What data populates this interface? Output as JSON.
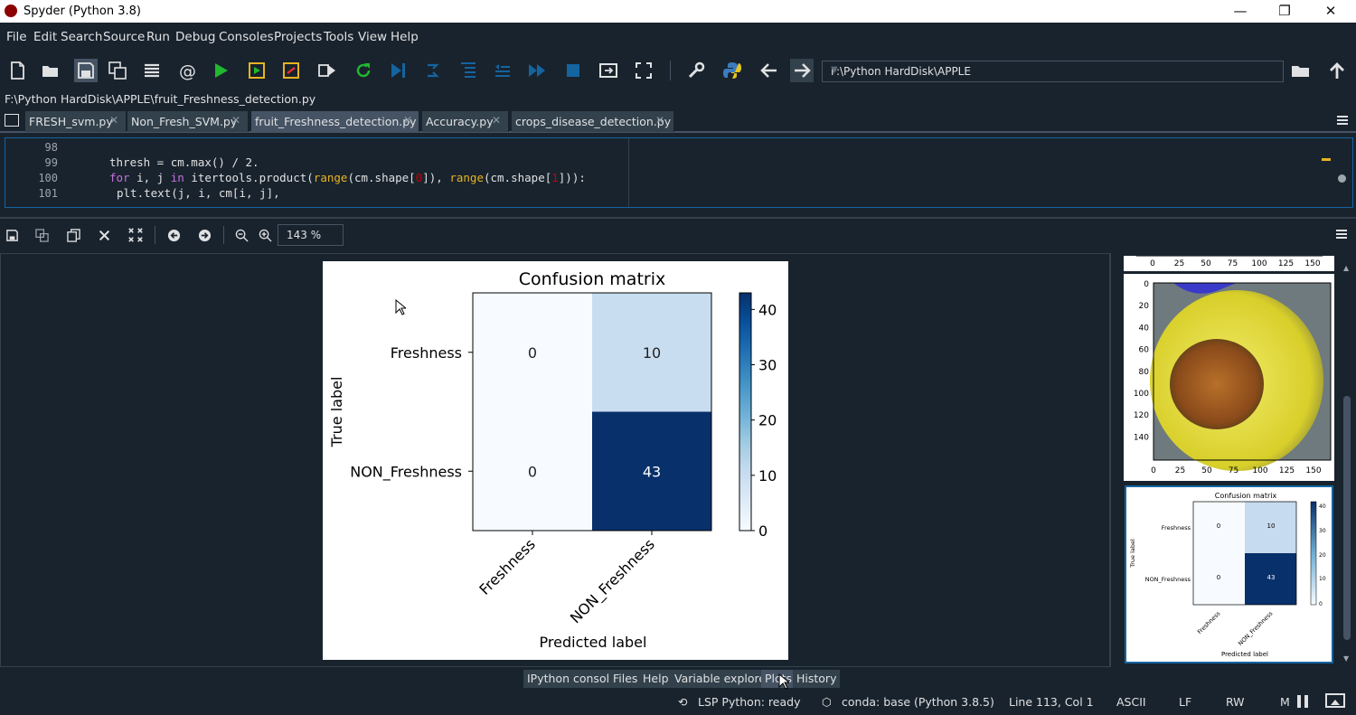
{
  "window": {
    "title": "Spyder (Python 3.8)",
    "minimize": "—",
    "maximize": "❐",
    "close": "✕"
  },
  "menu": [
    "File",
    "Edit",
    "Search",
    "Source",
    "Run",
    "Debug",
    "Consoles",
    "Projects",
    "Tools",
    "View",
    "Help"
  ],
  "toolbar": {
    "path": "F:\\Python HardDisk\\APPLE"
  },
  "editor": {
    "filepath": "F:\\Python HardDisk\\APPLE\\fruit_Freshness_detection.py",
    "tabs": [
      {
        "label": "FRESH_svm.py",
        "active": false
      },
      {
        "label": "Non_Fresh_SVM.py",
        "active": false
      },
      {
        "label": "fruit_Freshness_detection.py",
        "active": true
      },
      {
        "label": "Accuracy.py",
        "active": false
      },
      {
        "label": "crops_disease_detection.py",
        "active": false
      }
    ],
    "line_numbers": [
      "98",
      "99",
      "100",
      "101"
    ],
    "code_line1": "thresh = cm.max() / 2.",
    "code_line2_for": "for",
    "code_line2_mid": " i, j ",
    "code_line2_in": "in",
    "code_line2_a": " itertools.product(",
    "code_line2_range1": "range",
    "code_line2_b": "(cm.shape[",
    "code_line2_zero": "0",
    "code_line2_c": "]), ",
    "code_line2_range2": "range",
    "code_line2_d": "(cm.shape[",
    "code_line2_one": "1",
    "code_line2_e": "])):",
    "code_line3": "plt.text(j, i, cm[i, j],"
  },
  "plots": {
    "zoom": "143 %"
  },
  "chart_data": [
    {
      "type": "heatmap",
      "title": "Confusion matrix",
      "xlabel": "Predicted label",
      "ylabel": "True label",
      "x_categories": [
        "Freshness",
        "NON_Freshness"
      ],
      "y_categories": [
        "Freshness",
        "NON_Freshness"
      ],
      "values": [
        [
          0,
          10
        ],
        [
          0,
          43
        ]
      ],
      "colorbar_ticks": [
        0,
        10,
        20,
        30,
        40
      ],
      "colorbar_range": [
        0,
        43
      ],
      "colormap": "Blues"
    }
  ],
  "thumbnails": {
    "top_axis_ticks": [
      "0",
      "25",
      "50",
      "75",
      "100",
      "125",
      "150"
    ],
    "image_y_ticks": [
      "0",
      "20",
      "40",
      "60",
      "80",
      "100",
      "120",
      "140"
    ],
    "image_x_ticks": [
      "0",
      "25",
      "50",
      "75",
      "100",
      "125",
      "150"
    ],
    "cm_title": "Confusion matrix",
    "cm_ylabel": "True label",
    "cm_xlabel": "Predicted label",
    "cm_rows": [
      "Freshness",
      "NON_Freshness"
    ],
    "cm_cols": [
      "Freshness",
      "NON_Freshness"
    ],
    "cm_values": [
      "0",
      "10",
      "0",
      "43"
    ],
    "cm_cbar": [
      "40",
      "30",
      "20",
      "10",
      "0"
    ]
  },
  "pane_tabs": [
    {
      "label": "IPython console",
      "active": false
    },
    {
      "label": "Files",
      "active": false
    },
    {
      "label": "Help",
      "active": false
    },
    {
      "label": "Variable explorer",
      "active": false
    },
    {
      "label": "Plots",
      "active": true
    },
    {
      "label": "History",
      "active": false
    }
  ],
  "status": {
    "lsp": "LSP Python: ready",
    "conda": "conda: base (Python 3.8.5)",
    "position": "Line 113, Col 1",
    "encoding": "ASCII",
    "eol": "LF",
    "rw": "RW",
    "mem": "M"
  },
  "colors": {
    "bg": "#19232d",
    "accent": "#1464a0",
    "tab": "#32414b",
    "tab_active": "#455364"
  }
}
